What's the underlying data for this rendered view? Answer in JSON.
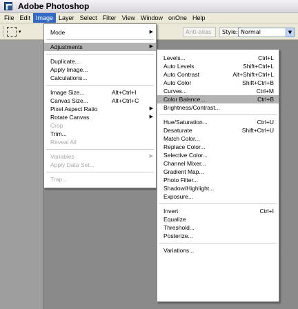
{
  "window": {
    "title": "Adobe Photoshop"
  },
  "menubar": [
    "File",
    "Edit",
    "Image",
    "Layer",
    "Select",
    "Filter",
    "View",
    "Window",
    "onOne",
    "Help"
  ],
  "options_bar": {
    "antialias_label": "Anti-alias",
    "style_label": "Style:",
    "style_value": "Normal"
  },
  "image_menu": {
    "mode": "Mode",
    "adjustments": "Adjustments",
    "duplicate": "Duplicate...",
    "apply_image": "Apply Image...",
    "calculations": "Calculations...",
    "image_size": "Image Size...",
    "image_size_sc": "Alt+Ctrl+I",
    "canvas_size": "Canvas Size...",
    "canvas_size_sc": "Alt+Ctrl+C",
    "pixel_aspect_ratio": "Pixel Aspect Ratio",
    "rotate_canvas": "Rotate Canvas",
    "crop": "Crop",
    "trim": "Trim...",
    "reveal_all": "Reveal All",
    "variables": "Variables",
    "apply_data_set": "Apply Data Set...",
    "trap": "Trap..."
  },
  "adjustments_menu": {
    "levels": "Levels...",
    "levels_sc": "Ctrl+L",
    "auto_levels": "Auto Levels",
    "auto_levels_sc": "Shift+Ctrl+L",
    "auto_contrast": "Auto Contrast",
    "auto_contrast_sc": "Alt+Shift+Ctrl+L",
    "auto_color": "Auto Color",
    "auto_color_sc": "Shift+Ctrl+B",
    "curves": "Curves...",
    "curves_sc": "Ctrl+M",
    "color_balance": "Color Balance...",
    "color_balance_sc": "Ctrl+B",
    "brightness_contrast": "Brightness/Contrast...",
    "hue_saturation": "Hue/Saturation...",
    "hue_saturation_sc": "Ctrl+U",
    "desaturate": "Desaturate",
    "desaturate_sc": "Shift+Ctrl+U",
    "match_color": "Match Color...",
    "replace_color": "Replace Color...",
    "selective_color": "Selective Color...",
    "channel_mixer": "Channel Mixer...",
    "gradient_map": "Gradient Map...",
    "photo_filter": "Photo Filter...",
    "shadow_highlight": "Shadow/Highlight...",
    "exposure": "Exposure...",
    "invert": "Invert",
    "invert_sc": "Ctrl+I",
    "equalize": "Equalize",
    "threshold": "Threshold...",
    "posterize": "Posterize...",
    "variations": "Variations..."
  },
  "colors": {
    "menu_highlight": "#316ac5",
    "selected_item": "#b3b3b3",
    "workspace": "#8a8a8a"
  }
}
